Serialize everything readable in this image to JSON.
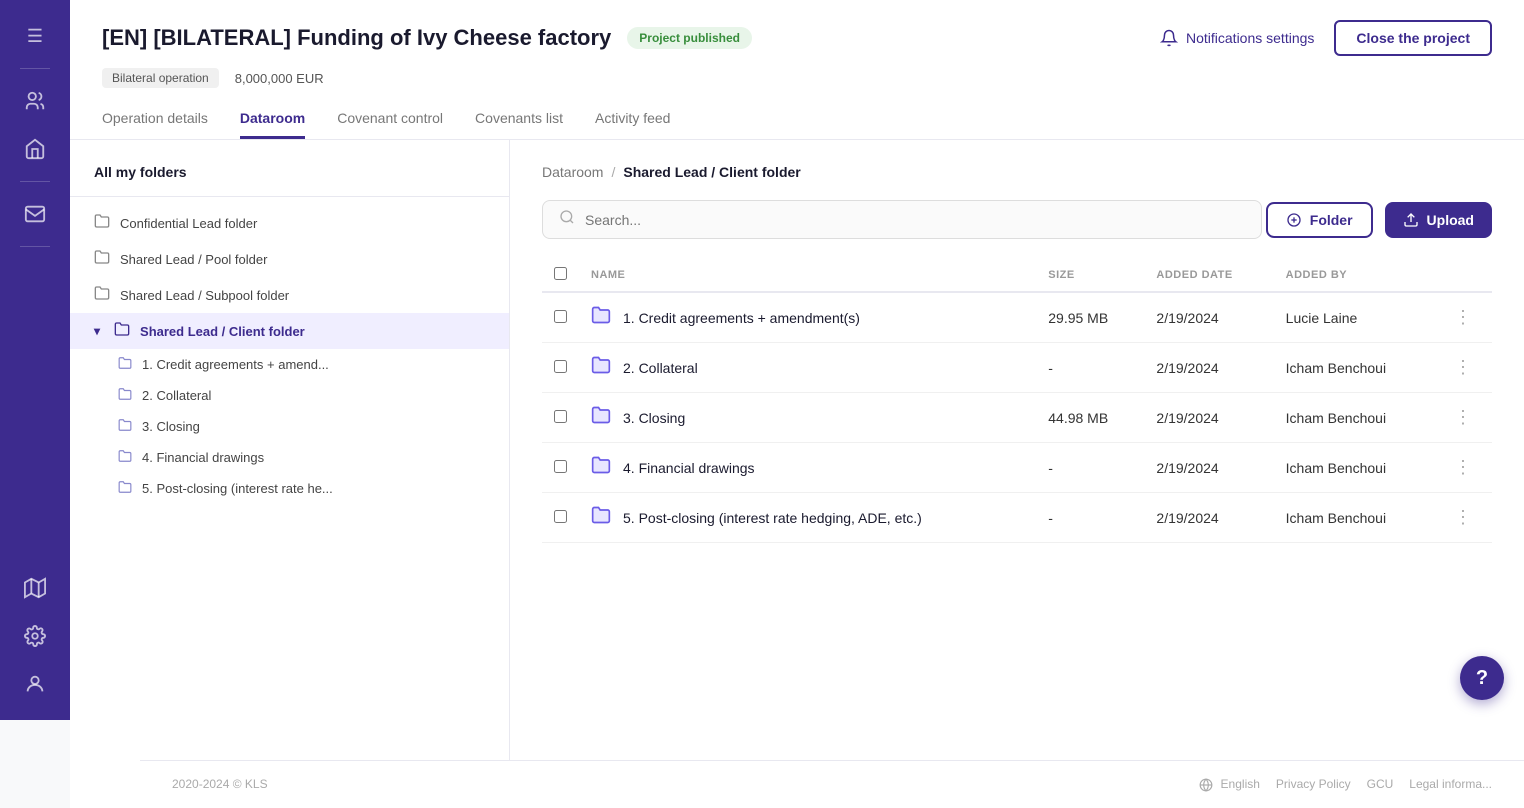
{
  "sidebar": {
    "icons": [
      {
        "name": "menu-icon",
        "symbol": "☰"
      },
      {
        "name": "users-icon",
        "symbol": "👥"
      },
      {
        "name": "bank-icon",
        "symbol": "🏦"
      },
      {
        "name": "divider1",
        "type": "divider"
      },
      {
        "name": "mail-icon",
        "symbol": "✉"
      },
      {
        "name": "divider2",
        "type": "divider"
      },
      {
        "name": "map-icon",
        "symbol": "🗺"
      },
      {
        "name": "settings-icon",
        "symbol": "⚙"
      },
      {
        "name": "user-circle-icon",
        "symbol": "👤"
      }
    ]
  },
  "header": {
    "title": "[EN] [BILATERAL] Funding of Ivy Cheese factory",
    "badge": "Project published",
    "operation_type": "Bilateral operation",
    "amount": "8,000,000 EUR",
    "notifications_label": "Notifications settings",
    "close_label": "Close the project"
  },
  "tabs": [
    {
      "id": "operation-details",
      "label": "Operation details",
      "active": false
    },
    {
      "id": "dataroom",
      "label": "Dataroom",
      "active": true
    },
    {
      "id": "covenant-control",
      "label": "Covenant control",
      "active": false
    },
    {
      "id": "covenants-list",
      "label": "Covenants list",
      "active": false
    },
    {
      "id": "activity-feed",
      "label": "Activity feed",
      "active": false
    }
  ],
  "folder_panel": {
    "title": "All my folders",
    "folders": [
      {
        "id": "confidential-lead",
        "label": "Confidential Lead folder",
        "active": false,
        "indent": 0
      },
      {
        "id": "shared-lead-pool",
        "label": "Shared Lead / Pool folder",
        "active": false,
        "indent": 0
      },
      {
        "id": "shared-lead-subpool",
        "label": "Shared Lead / Subpool folder",
        "active": false,
        "indent": 0
      },
      {
        "id": "shared-lead-client",
        "label": "Shared Lead / Client folder",
        "active": true,
        "indent": 0,
        "expanded": true
      }
    ],
    "subfolders": [
      {
        "id": "sub-credit",
        "label": "1. Credit agreements + amend...",
        "active": false
      },
      {
        "id": "sub-collateral",
        "label": "2. Collateral",
        "active": false
      },
      {
        "id": "sub-closing",
        "label": "3. Closing",
        "active": false
      },
      {
        "id": "sub-financial",
        "label": "4. Financial drawings",
        "active": false
      },
      {
        "id": "sub-postclosing",
        "label": "5. Post-closing (interest rate he...",
        "active": false
      }
    ]
  },
  "breadcrumb": {
    "root": "Dataroom",
    "separator": "/",
    "current": "Shared Lead / Client folder"
  },
  "search": {
    "placeholder": "Search..."
  },
  "toolbar": {
    "folder_btn": "Folder",
    "upload_btn": "Upload"
  },
  "table": {
    "columns": [
      "NAME",
      "SIZE",
      "ADDED DATE",
      "ADDED BY"
    ],
    "rows": [
      {
        "id": "row1",
        "name": "1. Credit agreements + amendment(s)",
        "size": "29.95 MB",
        "date": "2/19/2024",
        "user": "Lucie Laine"
      },
      {
        "id": "row2",
        "name": "2. Collateral",
        "size": "-",
        "date": "2/19/2024",
        "user": "Icham Benchoui"
      },
      {
        "id": "row3",
        "name": "3. Closing",
        "size": "44.98 MB",
        "date": "2/19/2024",
        "user": "Icham Benchoui"
      },
      {
        "id": "row4",
        "name": "4. Financial drawings",
        "size": "-",
        "date": "2/19/2024",
        "user": "Icham Benchoui"
      },
      {
        "id": "row5",
        "name": "5. Post-closing (interest rate hedging, ADE, etc.)",
        "size": "-",
        "date": "2/19/2024",
        "user": "Icham Benchoui"
      }
    ]
  },
  "footer": {
    "copyright": "2020-2024 © KLS",
    "links": [
      "English",
      "Privacy Policy",
      "GCU",
      "Legal informa..."
    ]
  },
  "help_btn": "?"
}
